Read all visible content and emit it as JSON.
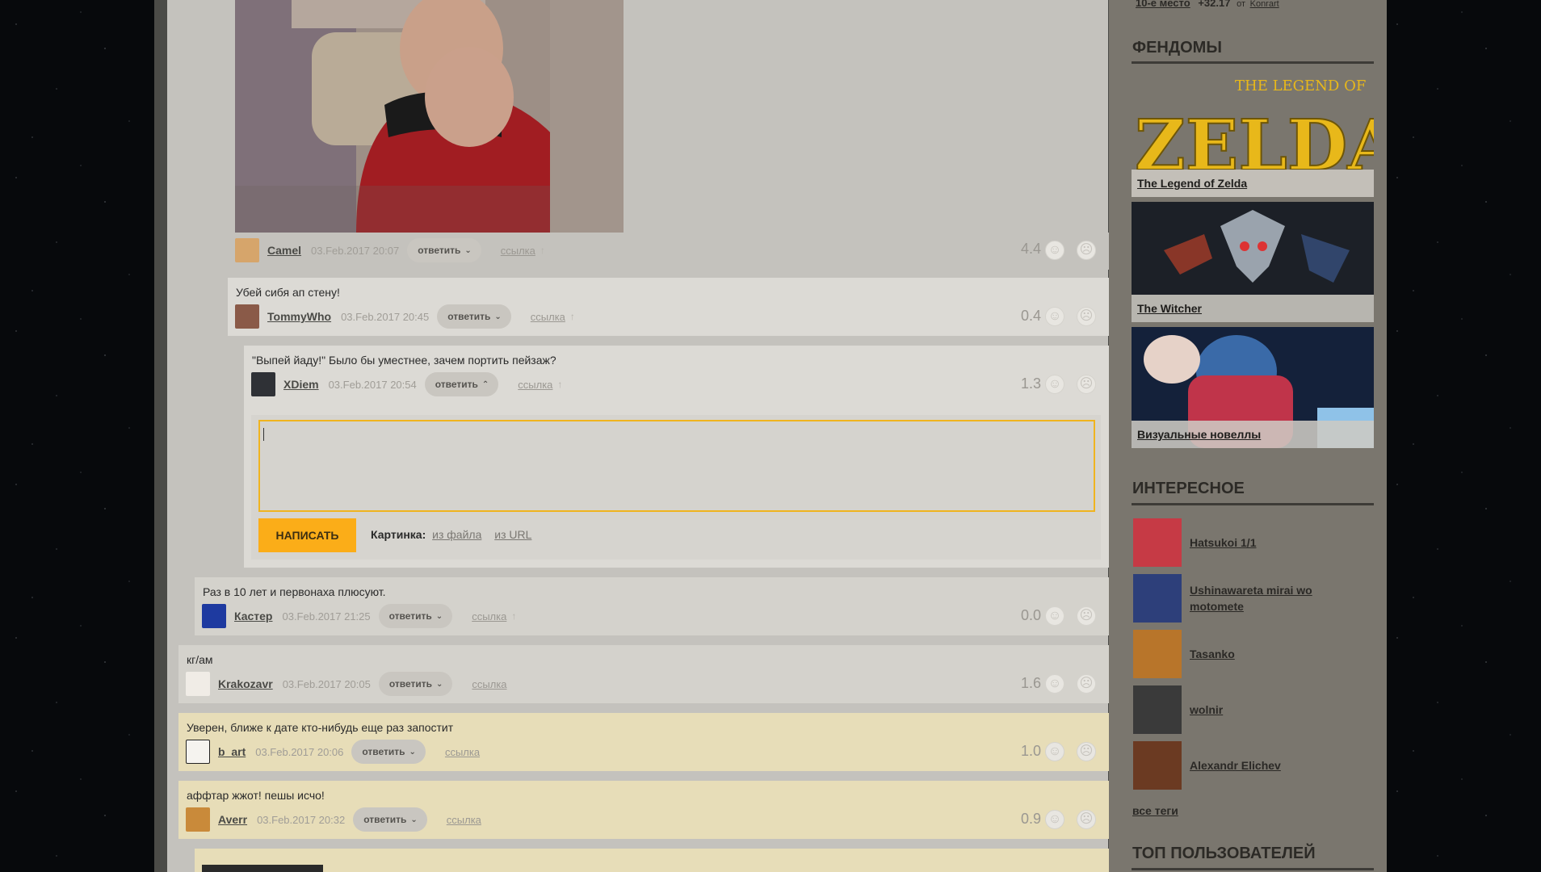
{
  "top_strip": {
    "place": "10-е место",
    "score": "+32.17",
    "from": "от",
    "user": "Konrart"
  },
  "comments": [
    {
      "id": "c0",
      "text": "",
      "user": "Camel",
      "date": "03.Feb.2017 20:07",
      "reply": "ответить",
      "link": "ссылка",
      "up": "↑",
      "score": "4.4"
    },
    {
      "id": "c1",
      "text": "Убей сибя ап стену!",
      "user": "TommyWho",
      "date": "03.Feb.2017 20:45",
      "reply": "ответить",
      "link": "ссылка",
      "up": "↑",
      "score": "0.4"
    },
    {
      "id": "c2",
      "text": "\"Выпей йаду!\" Было бы уместнее, зачем портить пейзаж?",
      "user": "XDiem",
      "date": "03.Feb.2017 20:54",
      "reply": "ответить",
      "link": "ссылка",
      "up": "↑",
      "score": "1.3"
    },
    {
      "id": "c3",
      "text": "Раз в 10 лет и первонаха плюсуют.",
      "user": "Кастер",
      "date": "03.Feb.2017 21:25",
      "reply": "ответить",
      "link": "ссылка",
      "up": "↑",
      "score": "0.0"
    },
    {
      "id": "c4",
      "text": "кг/ам",
      "user": "Krakozavr",
      "date": "03.Feb.2017 20:05",
      "reply": "ответить",
      "link": "ссылка",
      "score": "1.6"
    },
    {
      "id": "c5",
      "text": "Уверен, ближе к дате кто-нибудь еще раз запостит",
      "user": "b_art",
      "date": "03.Feb.2017 20:06",
      "reply": "ответить",
      "link": "ссылка",
      "score": "1.0"
    },
    {
      "id": "c6",
      "text": "аффтар жжот! пешы исчо!",
      "user": "Averr",
      "date": "03.Feb.2017 20:32",
      "reply": "ответить",
      "link": "ссылка",
      "score": "0.9"
    }
  ],
  "reply_form": {
    "submit": "НАПИСАТЬ",
    "picture_label": "Картинка:",
    "from_file": "из файла",
    "from_url": "из URL"
  },
  "sidebar": {
    "fandoms_title": "ФЕНДОМЫ",
    "fandoms": [
      {
        "name": "The Legend of Zelda",
        "logo_small": "THE LEGEND OF",
        "logo_big": "ZELDA"
      },
      {
        "name": "The Witcher"
      },
      {
        "name": "Визуальные новеллы"
      }
    ],
    "interesting_title": "ИНТЕРЕСНОЕ",
    "tags": [
      {
        "name": "Hatsukoi 1/1",
        "color": "#c63a45"
      },
      {
        "name": "Ushinawareta mirai wo motomete",
        "color": "#2d3f7a"
      },
      {
        "name": "Tasanko",
        "color": "#b8752a"
      },
      {
        "name": "wolnir",
        "color": "#3a3a3a"
      },
      {
        "name": "Alexandr Elichev",
        "color": "#6b3a22"
      }
    ],
    "all_tags": "все теги",
    "top_users_title": "ТОП ПОЛЬЗОВАТЕЛЕЙ"
  },
  "colors": {
    "accent": "#fbad18",
    "comment_bg": "#dcdad5",
    "highlight_bg": "#e7ddb8"
  }
}
